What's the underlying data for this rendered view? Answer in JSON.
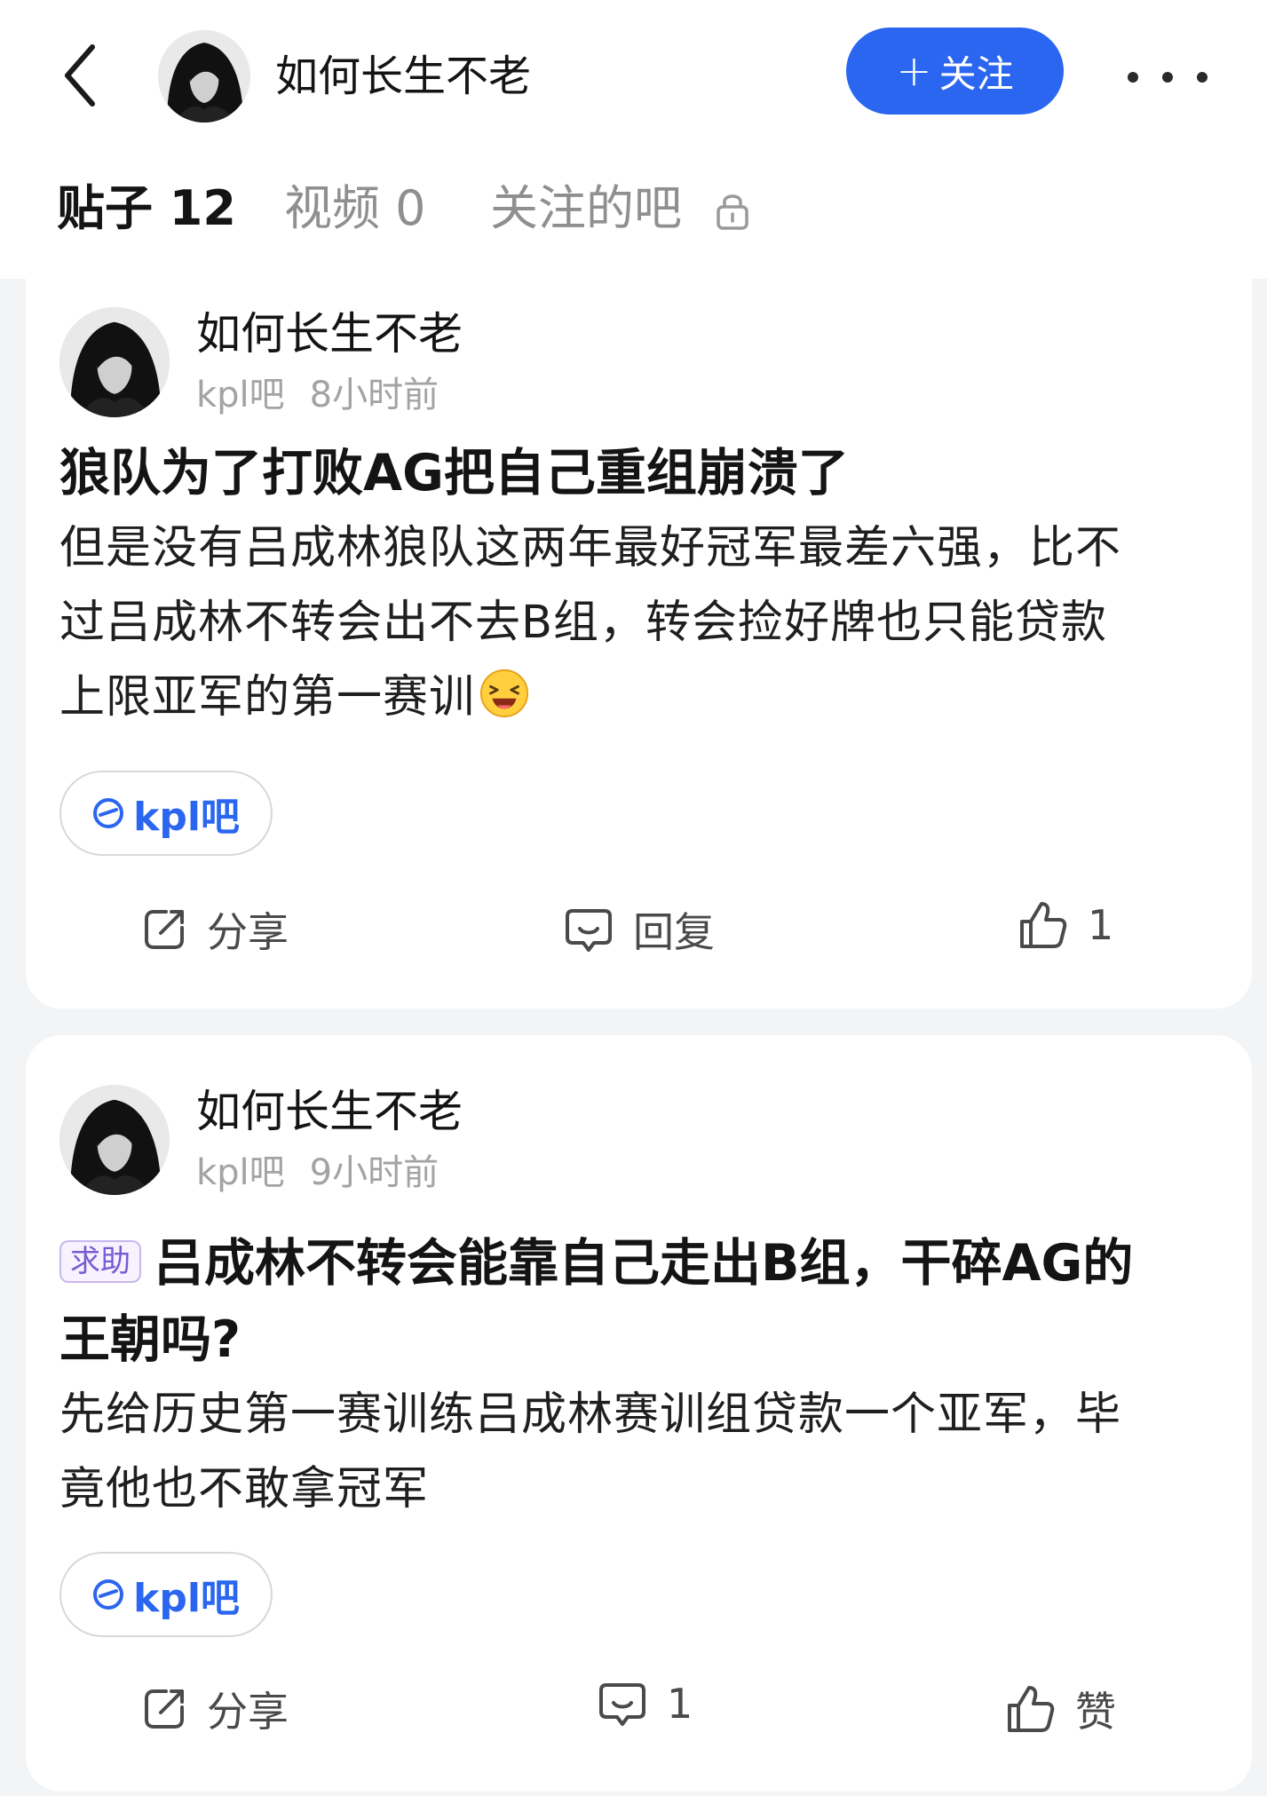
{
  "header": {
    "username": "如何长生不老",
    "follow_label": "关注",
    "follow_plus": "+"
  },
  "tabs": [
    {
      "label": "贴子 12",
      "active": true
    },
    {
      "label": "视频 0",
      "active": false
    },
    {
      "label": "关注的吧",
      "active": false,
      "icon": "lock-icon"
    }
  ],
  "posts": [
    {
      "author": "如何长生不老",
      "forum": "kpl吧",
      "time": "8小时前",
      "tag": "",
      "title": "狼队为了打败AG把自己重组崩溃了",
      "body_lines": [
        "但是没有吕成林狼队这两年最好冠军最差六强，比不",
        "过吕成林不转会出不去B组，转会捡好牌也只能贷款",
        "上限亚军的第一赛训"
      ],
      "emoji": "laughing-face-emoji",
      "chip": "kpl吧",
      "share_label": "分享",
      "reply_label": "回复",
      "like_label": "1"
    },
    {
      "author": "如何长生不老",
      "forum": "kpl吧",
      "time": "9小时前",
      "tag": "求助",
      "title_line1": "吕成林不转会能靠自己走出B组，干碎AG的",
      "title_line2": "王朝吗?",
      "body_lines": [
        "先给历史第一赛训练吕成林赛训组贷款一个亚军，毕",
        "竟他也不敢拿冠军"
      ],
      "chip": "kpl吧",
      "share_label": "分享",
      "reply_label": "1",
      "like_label": "赞"
    }
  ],
  "colors": {
    "accent": "#2b66f0",
    "background": "#f3f4f6",
    "tag_purple": "#7a5bd1"
  }
}
